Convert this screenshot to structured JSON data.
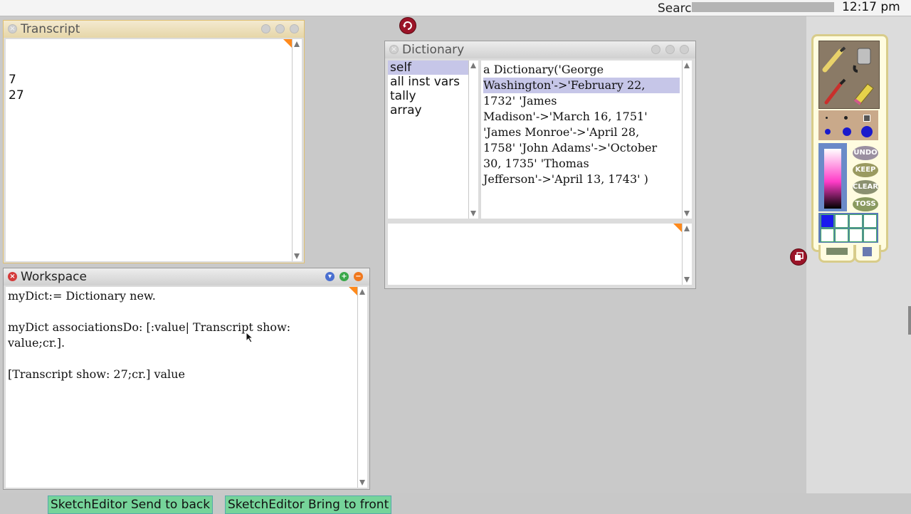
{
  "topbar": {
    "search_label": "Search",
    "clock": "12:17 pm"
  },
  "transcript": {
    "title": "Transcript",
    "lines": [
      "",
      "",
      "7",
      "27"
    ]
  },
  "workspace": {
    "title": "Workspace",
    "lines": [
      "myDict:= Dictionary new.",
      "",
      "myDict associationsDo: [:value| Transcript show:",
      "value;cr.].",
      "",
      "[Transcript show: 27;cr.] value"
    ]
  },
  "dictionary": {
    "title": "Dictionary",
    "fields": [
      "self",
      "all inst vars",
      "tally",
      "array"
    ],
    "selected_field": "self",
    "value_lines": [
      "a Dictionary('George",
      "Washington'->'February 22,",
      "1732' 'James",
      "Madison'->'March 16, 1751'",
      "'James Monroe'->'April 28,",
      "1758' 'John Adams'->'October",
      "30, 1735' 'Thomas",
      "Jefferson'->'April 13, 1743' )"
    ]
  },
  "palette": {
    "buttons": [
      "UNDO",
      "KEEP",
      "CLEAR",
      "TOSS"
    ]
  },
  "bottom_buttons": [
    "SketchEditor Send to back",
    "SketchEditor Bring to front"
  ],
  "colors": {
    "selection": "#c6c6e8",
    "halo": "#9b1428",
    "button_green": "#76d49a"
  }
}
